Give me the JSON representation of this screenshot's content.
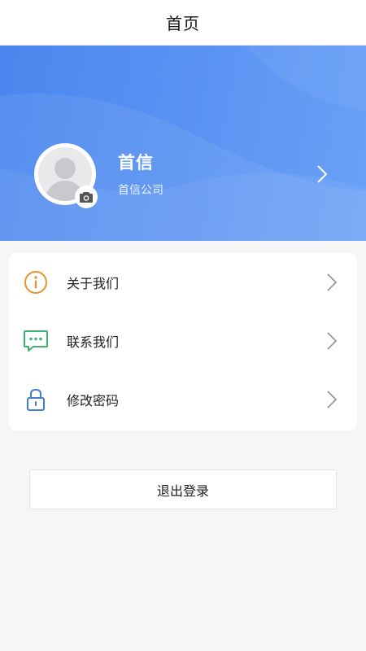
{
  "header": {
    "title": "首页"
  },
  "profile": {
    "name": "首信",
    "company": "首信公司"
  },
  "menu": {
    "items": [
      {
        "label": "关于我们",
        "icon": "info-icon",
        "color": "#e9932f"
      },
      {
        "label": "联系我们",
        "icon": "message-icon",
        "color": "#3cb36c"
      },
      {
        "label": "修改密码",
        "icon": "lock-icon",
        "color": "#3f7fd0"
      }
    ]
  },
  "logout": {
    "label": "退出登录"
  },
  "colors": {
    "banner": "#5b94f3",
    "background": "#f6f6f6",
    "chevron": "#8f99a8"
  }
}
